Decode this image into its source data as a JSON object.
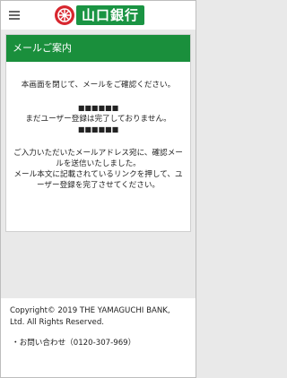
{
  "header": {
    "menu_icon": "hamburger-menu-icon",
    "logo_mark_icon": "bank-logo-mark-icon",
    "logo_text": "山口銀行",
    "logo_colors": {
      "mark": "#d7262e",
      "text_bg": "#1a9443"
    }
  },
  "notice": {
    "title": "メールご案内",
    "paragraph1": "本画面を閉じて、メールをご確認ください。",
    "masked1": "■■■■■■",
    "paragraph2": "まだユーザー登録は完了しておりません。",
    "masked2": "■■■■■■",
    "paragraph3": "ご入力いただいたメールアドレス宛に、確認メールを送信いたしました。",
    "paragraph4": "メール本文に記載されているリンクを押して、ユーザー登録を完了させてください。"
  },
  "footer": {
    "copyright": "Copyright© 2019 THE YAMAGUCHI BANK, Ltd. All Rights Reserved.",
    "contact": "・お問い合わせ（0120-307-969）"
  }
}
